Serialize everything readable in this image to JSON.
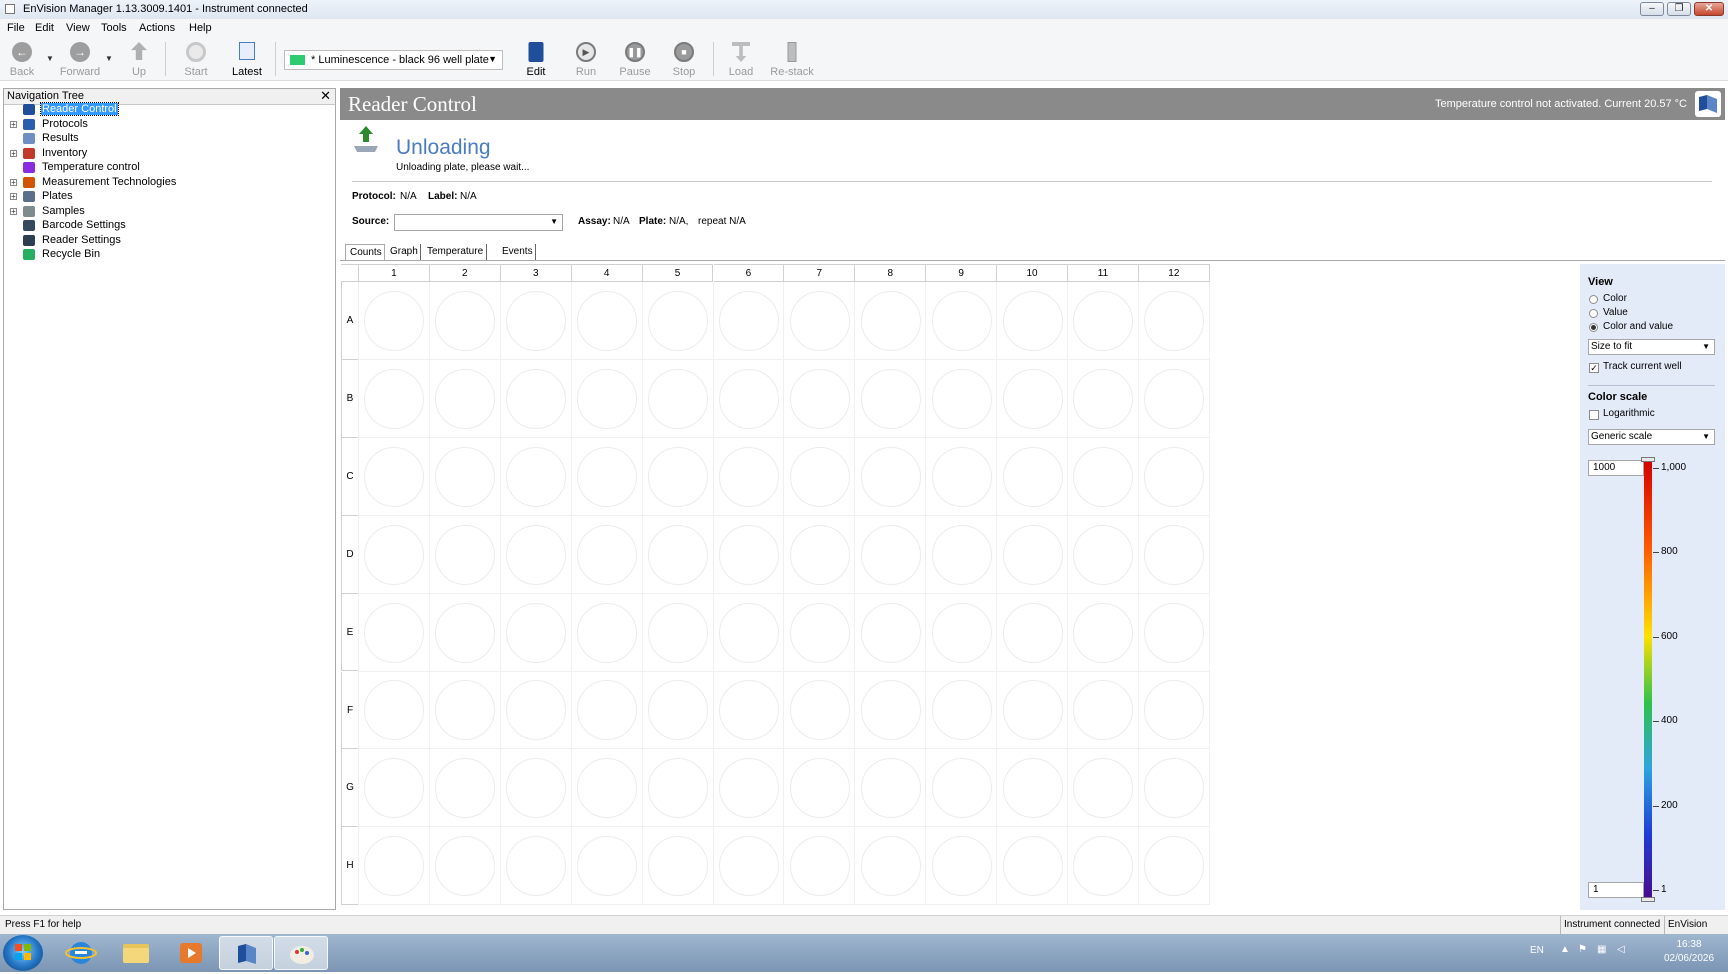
{
  "window": {
    "title": "EnVision Manager 1.13.3009.1401 - Instrument connected",
    "controls": {
      "minimize": "‒",
      "maximize": "❐",
      "close": "✕"
    }
  },
  "menu": [
    "File",
    "Edit",
    "View",
    "Tools",
    "Actions",
    "Help"
  ],
  "toolbar": {
    "back": "Back",
    "forward": "Forward",
    "up": "Up",
    "start": "Start",
    "latest": "Latest",
    "protocol_selected": "* Luminescence - black 96 well plate",
    "edit": "Edit",
    "run": "Run",
    "pause": "Pause",
    "stop": "Stop",
    "load": "Load",
    "restack": "Re-stack"
  },
  "nav": {
    "header": "Navigation Tree",
    "items": [
      {
        "label": "Reader Control",
        "icon": "reader-icon",
        "expand": ""
      },
      {
        "label": "Protocols",
        "icon": "protocols-icon",
        "expand": "+"
      },
      {
        "label": "Results",
        "icon": "results-icon",
        "expand": ""
      },
      {
        "label": "Inventory",
        "icon": "inventory-icon",
        "expand": "+"
      },
      {
        "label": "Temperature control",
        "icon": "thermometer-icon",
        "expand": ""
      },
      {
        "label": "Measurement Technologies",
        "icon": "technologies-icon",
        "expand": "+"
      },
      {
        "label": "Plates",
        "icon": "plates-icon",
        "expand": "+"
      },
      {
        "label": "Samples",
        "icon": "samples-icon",
        "expand": "+"
      },
      {
        "label": "Barcode Settings",
        "icon": "barcode-icon",
        "expand": ""
      },
      {
        "label": "Reader Settings",
        "icon": "settings-icon",
        "expand": ""
      },
      {
        "label": "Recycle Bin",
        "icon": "recycle-icon",
        "expand": ""
      }
    ]
  },
  "reader": {
    "title": "Reader Control",
    "temperature": "Temperature control not activated. Current 20.57 °C",
    "status": "Unloading",
    "status_detail": "Unloading plate, please wait...",
    "protocol_label": "Protocol:",
    "protocol_value": "N/A",
    "label_label": "Label:",
    "label_value": "N/A",
    "source_label": "Source:",
    "assay_label": "Assay:",
    "assay_value": "N/A",
    "plate_label": "Plate:",
    "plate_value": "N/A,",
    "repeat_text": "repeat N/A"
  },
  "tabs": [
    "Counts",
    "Graph",
    "Temperature",
    "Events"
  ],
  "plate": {
    "columns": [
      "1",
      "2",
      "3",
      "4",
      "5",
      "6",
      "7",
      "8",
      "9",
      "10",
      "11",
      "12"
    ],
    "rows": [
      "A",
      "B",
      "C",
      "D",
      "E",
      "F",
      "G",
      "H"
    ]
  },
  "view_panel": {
    "view_header": "View",
    "options": [
      "Color",
      "Value",
      "Color and value"
    ],
    "selected_option": "Color and value",
    "size_mode": "Size to fit",
    "track_current_well": "Track current well",
    "color_scale_header": "Color scale",
    "logarithmic": "Logarithmic",
    "scale_type": "Generic scale",
    "max_input": "1000",
    "min_input": "1",
    "scale_ticks": [
      "1,000",
      "800",
      "600",
      "400",
      "200",
      "1"
    ],
    "scale_tick_values": [
      1000,
      800,
      600,
      400,
      200,
      1
    ]
  },
  "statusbar": {
    "help": "Press F1 for help",
    "connection": "Instrument connected",
    "app": "EnVision"
  },
  "taskbar": {
    "lang": "EN",
    "time": "16:38",
    "date": "02/06/2026"
  }
}
